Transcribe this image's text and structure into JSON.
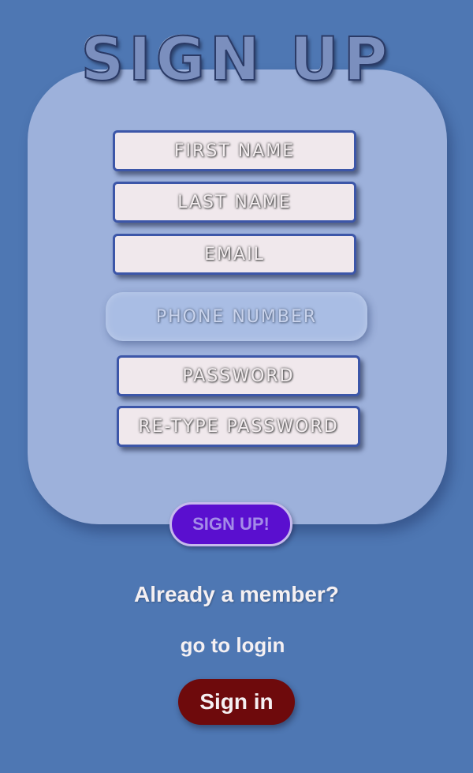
{
  "header": {
    "title": "SIGN UP"
  },
  "form": {
    "first_name_placeholder": "FIRST NAME",
    "last_name_placeholder": "LAST NAME",
    "email_placeholder": "EMAIL",
    "phone_placeholder": "PHONE NUMBER",
    "password_placeholder": "PASSWORD",
    "retype_password_placeholder": "RE-TYPE PASSWORD",
    "submit_label": "SIGN UP!"
  },
  "footer": {
    "member_prompt": "Already a member?",
    "login_hint": "go to login",
    "signin_label": "Sign in"
  },
  "colors": {
    "background": "#4e77b3",
    "card": "#9db1db",
    "field_border": "#3c56a8",
    "signup_button": "#5a0fcf",
    "signin_button": "#6e0a0c"
  }
}
